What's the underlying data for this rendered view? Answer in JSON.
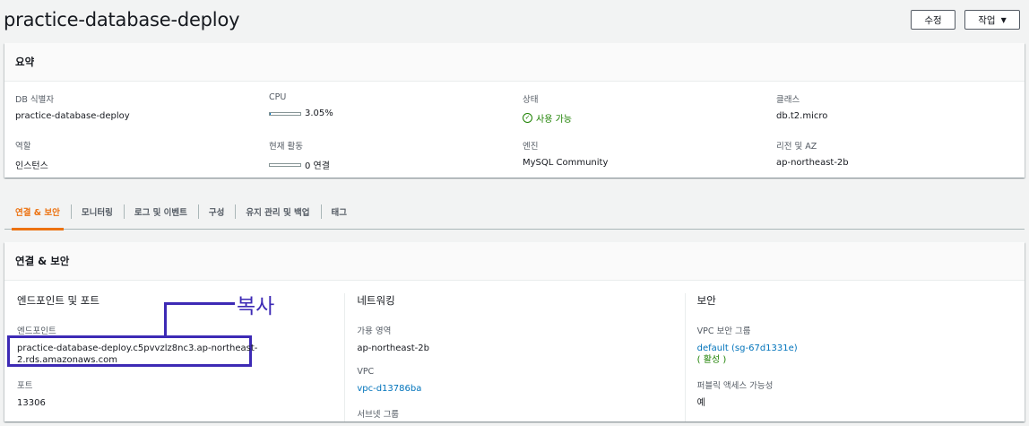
{
  "header": {
    "title": "practice-database-deploy",
    "edit_label": "수정",
    "actions_label": "작업"
  },
  "summary": {
    "title": "요약",
    "fields": {
      "db_id": {
        "label": "DB 식별자",
        "value": "practice-database-deploy"
      },
      "cpu": {
        "label": "CPU",
        "value": "3.05%",
        "percent": 3.05
      },
      "status": {
        "label": "상태",
        "value": "사용 가능"
      },
      "class": {
        "label": "클래스",
        "value": "db.t2.micro"
      },
      "role": {
        "label": "역할",
        "value": "인스턴스"
      },
      "activity": {
        "label": "현재 활동",
        "value": "0 연결",
        "percent": 0
      },
      "engine": {
        "label": "엔진",
        "value": "MySQL Community"
      },
      "region": {
        "label": "리전 및 AZ",
        "value": "ap-northeast-2b"
      }
    }
  },
  "tabs": [
    {
      "label": "연결 & 보안",
      "active": true
    },
    {
      "label": "모니터링"
    },
    {
      "label": "로그 및 이벤트"
    },
    {
      "label": "구성"
    },
    {
      "label": "유지 관리 및 백업"
    },
    {
      "label": "태그"
    }
  ],
  "connectivity": {
    "title": "연결 & 보안",
    "endpoint_section": {
      "title": "엔드포인트 및 포트",
      "endpoint_label": "엔드포인트",
      "endpoint_line1": "practice-database-deploy.c5pvvzlz8nc3.ap-northeast-",
      "endpoint_line2": "2.rds.amazonaws.com",
      "port_label": "포트",
      "port_value": "13306"
    },
    "network_section": {
      "title": "네트워킹",
      "az_label": "가용 영역",
      "az_value": "ap-northeast-2b",
      "vpc_label": "VPC",
      "vpc_value": "vpc-d13786ba",
      "subnet_label": "서브넷 그룹"
    },
    "security_section": {
      "title": "보안",
      "sg_label": "VPC 보안 그룹",
      "sg_value": "default (sg-67d1331e)",
      "sg_status": "( 활성 )",
      "public_label": "퍼블릭 액세스 가능성",
      "public_value": "예"
    }
  },
  "annotation": {
    "label": "복사"
  },
  "colors": {
    "accent": "#ec7211",
    "link": "#0073bb",
    "success": "#1d8102",
    "annotation": "#3d2ab5"
  }
}
